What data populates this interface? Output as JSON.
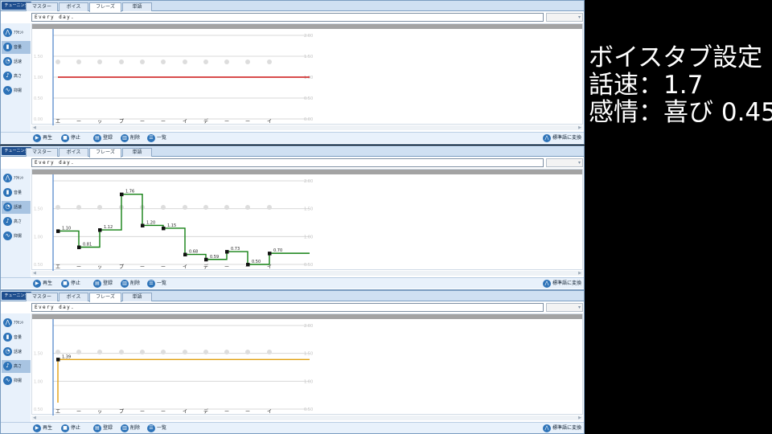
{
  "app": {
    "tuning_label": "チューニング",
    "tabs": [
      "マスター",
      "ボイス",
      "フレーズ",
      "単語"
    ],
    "text_input_value": "Every day.",
    "sidebar": [
      {
        "label": "ｱｸｾﾝﾄ",
        "icon": "accent-icon"
      },
      {
        "label": "音量",
        "icon": "volume-icon"
      },
      {
        "label": "話速",
        "icon": "speed-icon"
      },
      {
        "label": "高さ",
        "icon": "pitch-icon"
      },
      {
        "label": "抑揚",
        "icon": "intonation-icon"
      }
    ],
    "controls": {
      "play": "再生",
      "stop": "停止",
      "register": "登録",
      "delete": "削除",
      "list": "一覧",
      "convert": "標準語に変換"
    },
    "kana": [
      "エ",
      "ー",
      "ッ",
      "プ",
      "ー",
      "ー",
      "イ",
      "デ",
      "ー",
      "ー",
      "イ"
    ]
  },
  "panels": [
    {
      "active_sidebar": 1,
      "line_color": "#cc1111",
      "y_ticks": [
        "2.00",
        "1.50",
        "1.00",
        "0.50",
        "0.00"
      ],
      "y_min": 0,
      "y_max": 2,
      "show_labels": false,
      "values": [
        1.0,
        1.0,
        1.0,
        1.0,
        1.0,
        1.0,
        1.0,
        1.0,
        1.0,
        1.0,
        1.0
      ],
      "labels": []
    },
    {
      "active_sidebar": 2,
      "line_color": "#138013",
      "y_ticks": [
        "2.00",
        "1.50",
        "1.00",
        "0.50"
      ],
      "y_min": 0.5,
      "y_max": 2,
      "show_labels": true,
      "values": [
        1.1,
        0.81,
        1.12,
        1.76,
        1.2,
        1.15,
        0.68,
        0.59,
        0.73,
        0.5,
        0.7
      ],
      "labels": [
        "1.10",
        "0.81",
        "1.12",
        "1.76",
        "1.20",
        "1.15",
        "0.68",
        "0.59",
        "0.73",
        "0.50",
        "0.70"
      ]
    },
    {
      "active_sidebar": 3,
      "line_color": "#e0a010",
      "y_ticks": [
        "2.00",
        "1.50",
        "1.00",
        "0.50"
      ],
      "y_min": 0.5,
      "y_max": 2,
      "show_labels": true,
      "single_point": true,
      "values": [
        1.39
      ],
      "labels": [
        "1.39"
      ]
    }
  ],
  "annotation": {
    "line1": "ボイスタブ設定",
    "line2": "話速：1.7",
    "line3": "感情：喜び 0.45"
  }
}
